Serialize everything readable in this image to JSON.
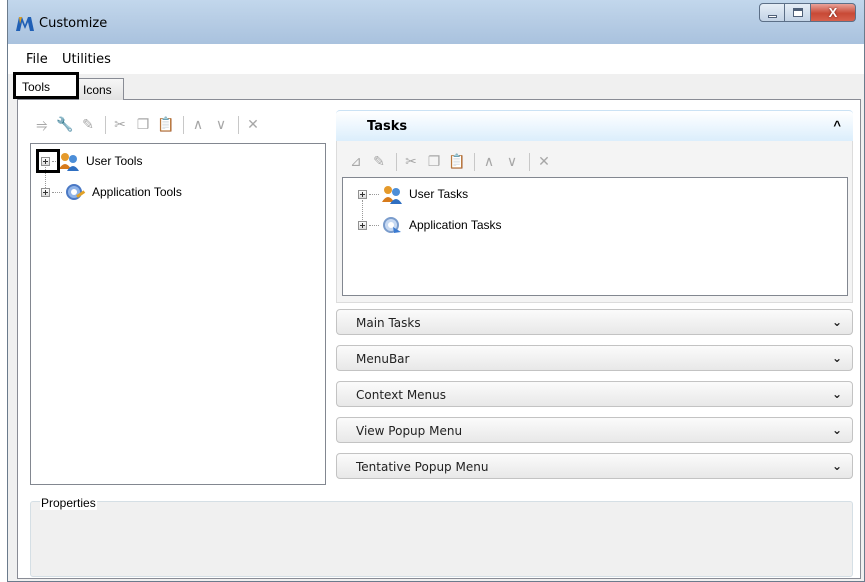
{
  "window": {
    "title": "Customize",
    "app_icon": "microstation-icon"
  },
  "titlebar_buttons": {
    "minimize": "minimize-icon",
    "maximize": "maximize-icon",
    "close_glyph": "X"
  },
  "menu": {
    "items": [
      "File",
      "Utilities"
    ]
  },
  "tabs": [
    {
      "label": "Tools",
      "active": true
    },
    {
      "label": "Icons",
      "active": false
    }
  ],
  "left_toolbar": {
    "icons": [
      "insert-icon",
      "wrench-icon",
      "wrench-edit-icon",
      "cut-icon",
      "copy-icon",
      "paste-icon",
      "move-up-icon",
      "move-down-icon",
      "delete-icon"
    ]
  },
  "left_tree": {
    "nodes": [
      {
        "label": "User Tools",
        "icon": "user-tools-icon"
      },
      {
        "label": "Application Tools",
        "icon": "application-tools-icon"
      }
    ]
  },
  "tasks_panel": {
    "title": "Tasks",
    "toolbar_icons": [
      "new-task-icon",
      "edit-task-icon",
      "cut-icon",
      "copy-icon",
      "paste-icon",
      "move-up-icon",
      "move-down-icon",
      "delete-icon"
    ],
    "nodes": [
      {
        "label": "User Tasks",
        "icon": "user-tasks-icon"
      },
      {
        "label": "Application Tasks",
        "icon": "application-tasks-icon"
      }
    ]
  },
  "accordion_sections": [
    "Main Tasks",
    "MenuBar",
    "Context Menus",
    "View Popup Menu",
    "Tentative Popup Menu"
  ],
  "properties": {
    "label": "Properties"
  }
}
